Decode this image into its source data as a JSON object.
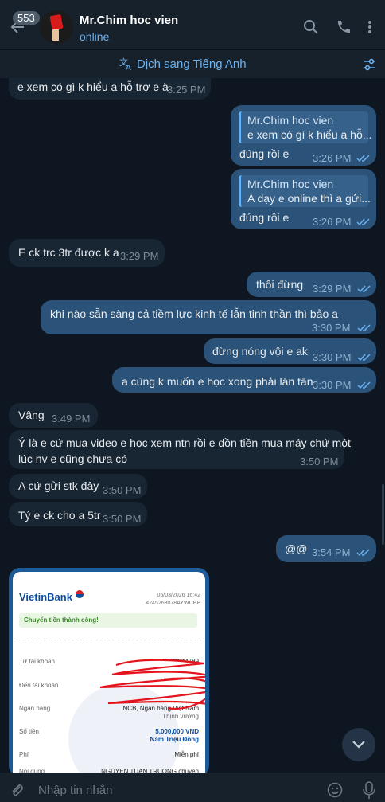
{
  "header": {
    "badge_count": "553",
    "contact_name": "Mr.Chim hoc vien",
    "status": "online",
    "translate_label": "Dịch sang Tiếng Anh"
  },
  "messages": [
    {
      "text": "e xem có gì k hiểu a hỗ trợ e à",
      "time": "3:25 PM"
    },
    {
      "reply_name": "Mr.Chim hoc vien",
      "reply_text": "e xem có gì k hiểu a hỗ...",
      "text": "đúng rồi e",
      "time": "3:26 PM"
    },
    {
      "reply_name": "Mr.Chim hoc vien",
      "reply_text": "A dạy e online thì a gửi...",
      "text": "đúng rồi e",
      "time": "3:26 PM"
    },
    {
      "text": "E ck trc 3tr được k a",
      "time": "3:29 PM"
    },
    {
      "text": "thôi đừng",
      "time": "3:29 PM"
    },
    {
      "text": "khi nào sẵn sàng cả tiềm lực kinh tế lẫn tinh thần thì bảo a",
      "time": "3:30 PM"
    },
    {
      "text": "đừng nóng vội e ak",
      "time": "3:30 PM"
    },
    {
      "text": "a cũng k muốn e học xong phải lăn tăn",
      "time": "3:30 PM"
    },
    {
      "text": "Vâng",
      "time": "3:49 PM"
    },
    {
      "line1": "Ý là e cứ mua video e học xem ntn rồi e dồn tiền mua máy chứ một",
      "line2": "lúc nv e cũng chưa có",
      "time": "3:50 PM"
    },
    {
      "text": "A cứ gửi stk đây",
      "time": "3:50 PM"
    },
    {
      "text": "Tý e ck cho a 5tr",
      "time": "3:50 PM"
    },
    {
      "text": "@@",
      "time": "3:54 PM"
    }
  ],
  "receipt": {
    "bank": "VietinBank",
    "datetime": "05/03/2026 16:42",
    "ref": "4245263078AYWUBP",
    "success": "Chuyển tiền thành công!",
    "rows": [
      {
        "label": "Từ tài khoản",
        "value": "*********4789"
      },
      {
        "label": "Đến tài khoản",
        "value": ""
      },
      {
        "label": "Ngân hàng",
        "value": "NCB, Ngân hàng Việt Nam",
        "value2": "Thịnh vượng"
      },
      {
        "label": "Số tiền",
        "value": "5,000,000 VND",
        "value2": "Năm Triệu Đồng"
      },
      {
        "label": "Phí",
        "value": "Miễn phí"
      },
      {
        "label": "Nội dung",
        "value": "NGUYEN TUAN TRUONG chuyen"
      }
    ]
  },
  "composer": {
    "placeholder": "Nhập tin nhắn"
  },
  "colors": {
    "accent": "#6ab2f2",
    "bg": "#0e1621",
    "outgoing": "#2b5278",
    "incoming": "#182533"
  }
}
